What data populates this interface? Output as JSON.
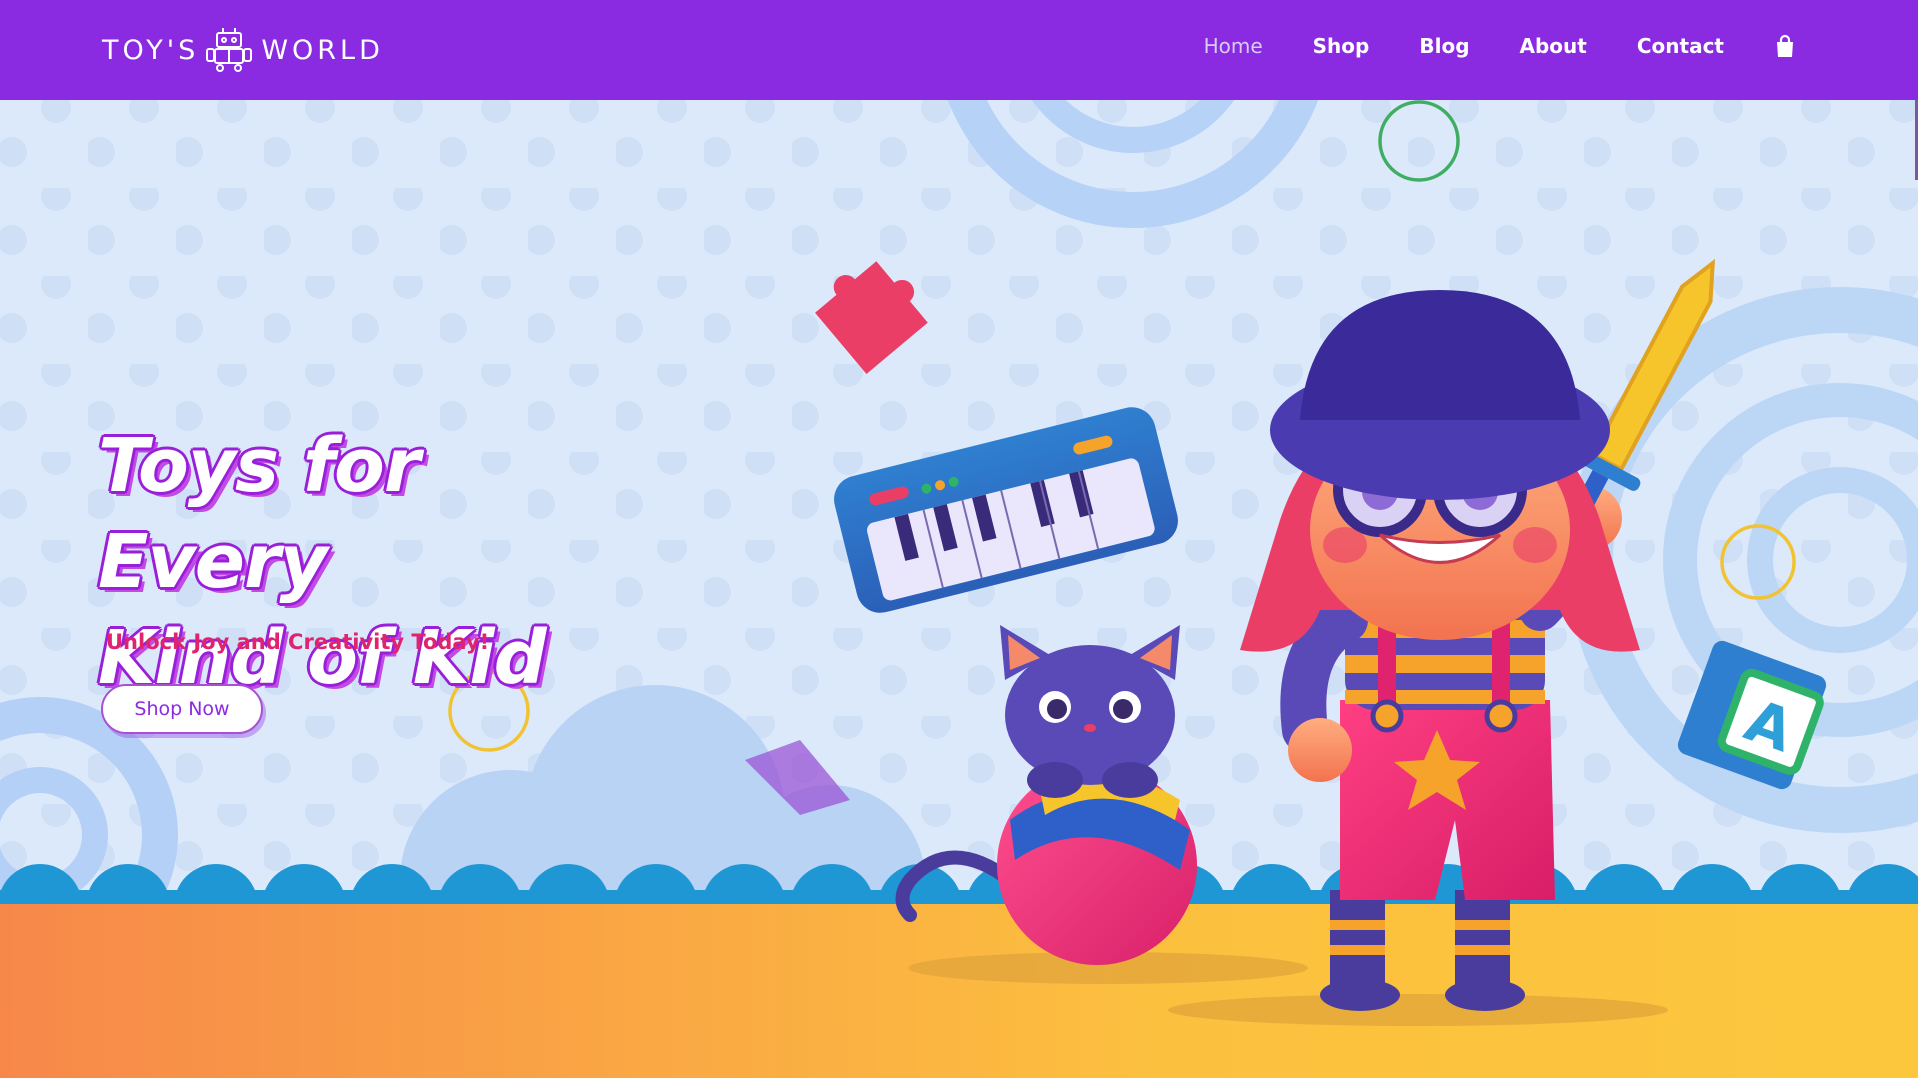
{
  "brand": {
    "name_left": "TOY'S",
    "name_right": "WORLD",
    "logo_icon": "robot-icon"
  },
  "nav": {
    "items": [
      {
        "label": "Home",
        "active": true
      },
      {
        "label": "Shop",
        "active": false
      },
      {
        "label": "Blog",
        "active": false
      },
      {
        "label": "About",
        "active": false
      },
      {
        "label": "Contact",
        "active": false
      }
    ],
    "cart_icon": "shopping-bag-icon"
  },
  "hero": {
    "title_line1": "Toys for Every",
    "title_line2": "Kind of Kid",
    "subtitle": "Unlock Joy and Creativity Today!",
    "cta_label": "Shop Now"
  },
  "colors": {
    "nav_bg": "#8a2be2",
    "hero_bg": "#dbe9fb",
    "accent_pink": "#e0236f",
    "ground_orange": "#f7884a",
    "ground_yellow": "#fcc73d",
    "wave_blue": "#1f97d4"
  }
}
